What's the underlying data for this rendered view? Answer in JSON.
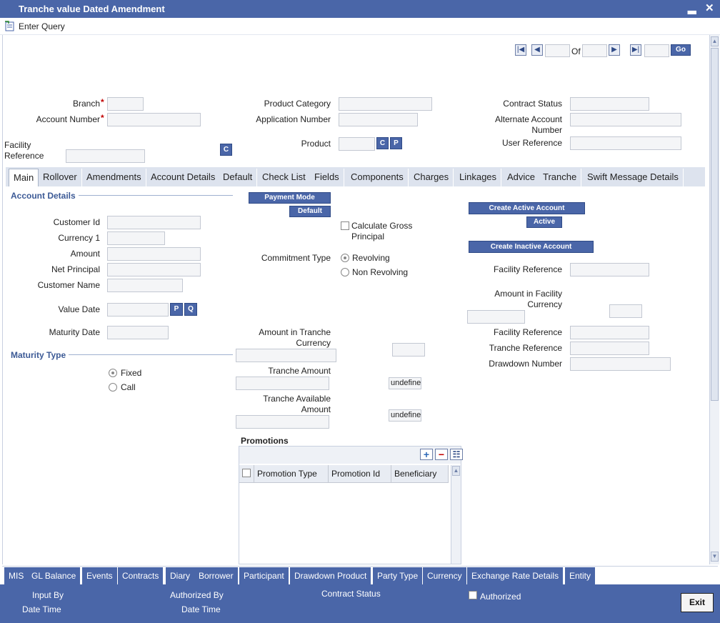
{
  "window": {
    "title": "Tranche value Dated Amendment",
    "minimize": "▂",
    "close": "✕"
  },
  "toolbar": {
    "enter_query": "Enter Query"
  },
  "pager": {
    "of_label": "Of",
    "go_label": "Go",
    "current": "",
    "total": ""
  },
  "header": {
    "branch_label": "Branch",
    "account_number_label": "Account Number",
    "facility_reference_label": "Facility Reference",
    "product_category_label": "Product Category",
    "application_number_label": "Application Number",
    "product_label": "Product",
    "contract_status_label": "Contract Status",
    "alternate_account_label": "Alternate Account Number",
    "user_reference_label": "User Reference",
    "c_button": "C",
    "p_button": "P",
    "required_mark": "*"
  },
  "tabs": [
    {
      "label": "Main"
    },
    {
      "label": "Rollover"
    },
    {
      "label": "Amendments"
    },
    {
      "label": "Account Details"
    },
    {
      "label": "Default"
    },
    {
      "label": "Check List"
    },
    {
      "label": "Fields"
    },
    {
      "label": "Components"
    },
    {
      "label": "Charges"
    },
    {
      "label": "Linkages"
    },
    {
      "label": "Advice"
    },
    {
      "label": "Tranche"
    },
    {
      "label": "Swift Message Details"
    }
  ],
  "main": {
    "account_details_heading": "Account Details",
    "customer_id_label": "Customer Id",
    "currency_label": "Currency 1",
    "amount_label": "Amount",
    "net_principal_label": "Net Principal",
    "customer_name_label": "Customer Name",
    "value_date_label": "Value Date",
    "maturity_date_label": "Maturity Date",
    "p_button": "P",
    "q_button": "Q",
    "maturity_type_heading": "Maturity Type",
    "fixed_label": "Fixed",
    "call_label": "Call",
    "payment_mode_button": "Payment Mode",
    "default_button": "Default",
    "calculate_gross_label": "Calculate Gross Principal",
    "commitment_type_label": "Commitment Type",
    "revolving_label": "Revolving",
    "non_revolving_label": "Non Revolving",
    "amount_tranche_ccy_label": "Amount in Tranche Currency",
    "tranche_amount_label": "Tranche Amount",
    "tranche_amount_value": "undefined",
    "tranche_available_label": "Tranche Available Amount",
    "tranche_available_value": "undefined",
    "create_active_button": "Create Active Account",
    "active_button": "Active",
    "create_inactive_button": "Create Inactive Account",
    "facility_reference_label": "Facility Reference",
    "amount_facility_ccy_label": "Amount in Facility Currency",
    "facility_reference2_label": "Facility Reference",
    "tranche_reference_label": "Tranche Reference",
    "drawdown_number_label": "Drawdown Number"
  },
  "promotions": {
    "heading": "Promotions",
    "columns": [
      "Promotion Type",
      "Promotion Id",
      "Beneficiary"
    ],
    "add_icon": "+",
    "remove_icon": "−",
    "view_icon": "☷"
  },
  "footer_tabs": [
    {
      "label": "MIS"
    },
    {
      "label": "GL Balance"
    },
    {
      "label": "Events"
    },
    {
      "label": "Contracts"
    },
    {
      "label": "Diary"
    },
    {
      "label": "Borrower"
    },
    {
      "label": "Participant"
    },
    {
      "label": "Drawdown Product"
    },
    {
      "label": "Party Type"
    },
    {
      "label": "Currency"
    },
    {
      "label": "Exchange Rate Details"
    },
    {
      "label": "Entity"
    }
  ],
  "footer": {
    "input_by": "Input By",
    "date_time": "Date Time",
    "authorized_by": "Authorized By",
    "date_time2": "Date Time",
    "contract_status": "Contract Status",
    "authorized": "Authorized",
    "exit": "Exit"
  },
  "colors": {
    "accent": "#4a66a8",
    "tab_bg": "#dde3ee",
    "heading": "#3c5a96"
  }
}
